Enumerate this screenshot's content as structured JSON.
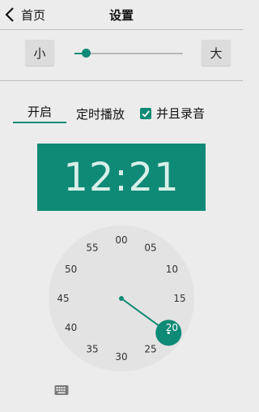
{
  "header": {
    "back_label": "首页",
    "title": "设置"
  },
  "text_size": {
    "small_label": "小",
    "large_label": "大",
    "level": 0.05
  },
  "options": {
    "toggle_label": "开启",
    "schedule_label": "定时播放",
    "record_label": "并且录音",
    "record_checked": true
  },
  "time": {
    "display": "12:21",
    "selected_minute": 21,
    "dial_labels": [
      "00",
      "05",
      "10",
      "15",
      "20",
      "25",
      "30",
      "35",
      "40",
      "45",
      "50",
      "55"
    ]
  },
  "colors": {
    "accent": "#0f8a76",
    "clock_face": "#e3e3e3",
    "background": "#ececec"
  },
  "icons": {
    "back": "chevron-left-icon",
    "check": "check-icon",
    "keyboard": "keyboard-icon"
  }
}
